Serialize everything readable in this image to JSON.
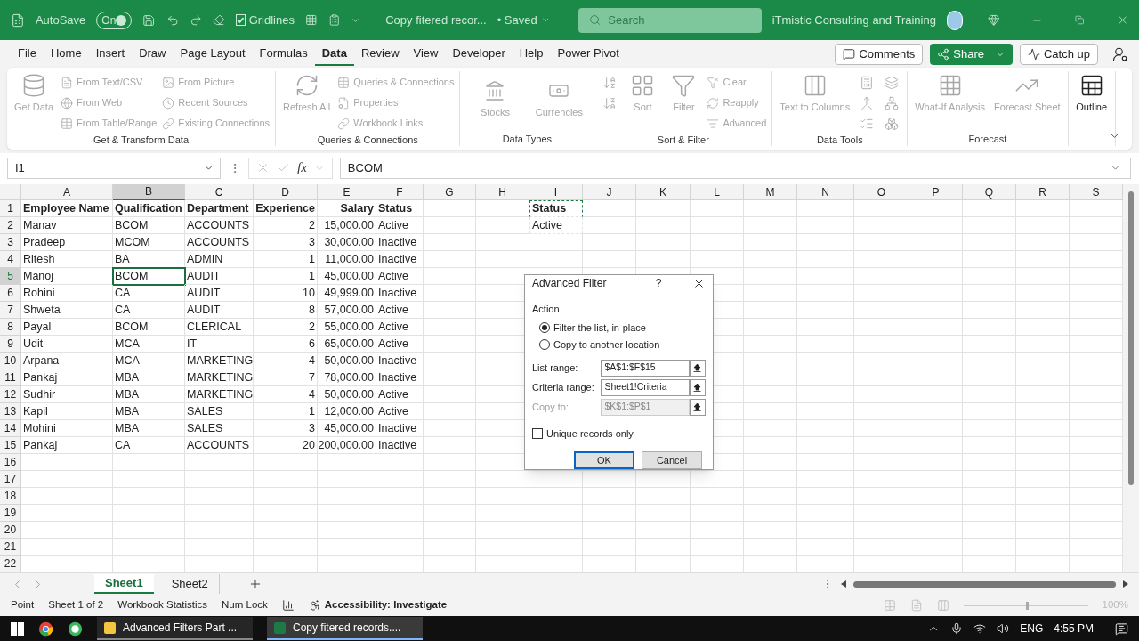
{
  "title_bar": {
    "autosave_label": "AutoSave",
    "autosave": {
      "label": "On",
      "on": true
    },
    "gridlines": {
      "label": "Gridlines",
      "checked": true
    },
    "document_title": "Copy fitered recor...",
    "save_status": "• Saved",
    "search": {
      "placeholder": "Search"
    },
    "account": "iTmistic Consulting and Training"
  },
  "menu_tabs": [
    {
      "label": "File",
      "selected": false
    },
    {
      "label": "Home",
      "selected": false
    },
    {
      "label": "Insert",
      "selected": false
    },
    {
      "label": "Draw",
      "selected": false
    },
    {
      "label": "Page Layout",
      "selected": false
    },
    {
      "label": "Formulas",
      "selected": false
    },
    {
      "label": "Data",
      "selected": true
    },
    {
      "label": "Review",
      "selected": false
    },
    {
      "label": "View",
      "selected": false
    },
    {
      "label": "Developer",
      "selected": false
    },
    {
      "label": "Help",
      "selected": false
    },
    {
      "label": "Power Pivot",
      "selected": false
    }
  ],
  "top_buttons": [
    {
      "label": "Comments",
      "kind": "outline"
    },
    {
      "label": "Share",
      "kind": "primary"
    },
    {
      "label": "Catch up",
      "kind": "outline"
    }
  ],
  "ribbon": [
    {
      "name": "Get & Transform Data",
      "items": [
        {
          "kind": "large",
          "label": "Get Data",
          "disabled": true
        },
        {
          "kind": "small",
          "label": "From Text/CSV",
          "disabled": true
        },
        {
          "kind": "small",
          "label": "From Web",
          "disabled": true
        },
        {
          "kind": "small",
          "label": "From Table/Range",
          "disabled": true
        },
        {
          "kind": "small",
          "label": "From Picture",
          "disabled": true
        },
        {
          "kind": "small",
          "label": "Recent Sources",
          "disabled": true
        },
        {
          "kind": "small",
          "label": "Existing Connections",
          "disabled": true
        }
      ]
    },
    {
      "name": "Queries & Connections",
      "items": [
        {
          "kind": "large",
          "label": "Refresh All",
          "disabled": true
        },
        {
          "kind": "small",
          "label": "Queries & Connections",
          "disabled": true
        },
        {
          "kind": "small",
          "label": "Properties",
          "disabled": true
        },
        {
          "kind": "small",
          "label": "Workbook Links",
          "disabled": true
        }
      ]
    },
    {
      "name": "Data Types",
      "items": [
        {
          "kind": "tile",
          "label": "Stocks",
          "disabled": true
        },
        {
          "kind": "tile",
          "label": "Currencies",
          "disabled": true
        }
      ]
    },
    {
      "name": "Sort & Filter",
      "items": [
        {
          "kind": "icon",
          "disabled": true
        },
        {
          "kind": "icon",
          "disabled": true
        },
        {
          "kind": "large",
          "label": "Sort",
          "disabled": true
        },
        {
          "kind": "large",
          "label": "Filter",
          "disabled": true
        },
        {
          "kind": "small",
          "label": "Clear",
          "disabled": true
        },
        {
          "kind": "small",
          "label": "Reapply",
          "disabled": true
        },
        {
          "kind": "small",
          "label": "Advanced",
          "disabled": true
        }
      ]
    },
    {
      "name": "Data Tools",
      "items": [
        {
          "kind": "large",
          "label": "Text to Columns",
          "disabled": true
        },
        {
          "kind": "icon",
          "disabled": true
        },
        {
          "kind": "icon",
          "disabled": true
        },
        {
          "kind": "icon",
          "disabled": true
        },
        {
          "kind": "icon",
          "disabled": true
        },
        {
          "kind": "icon",
          "disabled": true
        },
        {
          "kind": "icon",
          "disabled": true
        }
      ]
    },
    {
      "name": "Forecast",
      "items": [
        {
          "kind": "large",
          "label": "What-If Analysis",
          "disabled": true
        },
        {
          "kind": "large",
          "label": "Forecast Sheet",
          "disabled": true
        }
      ]
    },
    {
      "items": [
        {
          "kind": "large",
          "label": "Outline",
          "disabled": false
        }
      ]
    }
  ],
  "formula_bar": {
    "name_box": "I1",
    "fx": "fx",
    "value": "BCOM"
  },
  "columns": [
    {
      "label": "A",
      "selected": false,
      "numeric": false
    },
    {
      "label": "B",
      "selected": true,
      "numeric": false
    },
    {
      "label": "C",
      "selected": false,
      "numeric": false
    },
    {
      "label": "D",
      "selected": false,
      "numeric": true
    },
    {
      "label": "E",
      "selected": false,
      "numeric": true
    },
    {
      "label": "F",
      "selected": false,
      "numeric": false
    },
    {
      "label": "G",
      "selected": false
    },
    {
      "label": "H",
      "selected": false
    },
    {
      "label": "I",
      "selected": false
    },
    {
      "label": "J",
      "selected": false
    },
    {
      "label": "K",
      "selected": false
    },
    {
      "label": "L",
      "selected": false
    },
    {
      "label": "M",
      "selected": false
    },
    {
      "label": "N",
      "selected": false
    },
    {
      "label": "O",
      "selected": false
    },
    {
      "label": "P",
      "selected": false
    },
    {
      "label": "Q",
      "selected": false
    },
    {
      "label": "R",
      "selected": false
    },
    {
      "label": "S",
      "selected": false
    }
  ],
  "criteria": {
    "header": "Status",
    "value": "Active"
  },
  "rows": [
    {
      "number": "1",
      "kind": "header",
      "selected": false,
      "cells": [
        "Employee Name",
        "Qualification",
        "Department",
        "Experience",
        "Salary",
        "Status"
      ]
    },
    {
      "number": "2",
      "kind": "data",
      "selected": false,
      "cells": [
        "Manav",
        "BCOM",
        "ACCOUNTS",
        "2",
        "15,000.00",
        "Active"
      ]
    },
    {
      "number": "3",
      "kind": "data",
      "selected": false,
      "cells": [
        "Pradeep",
        "MCOM",
        "ACCOUNTS",
        "3",
        "30,000.00",
        "Inactive"
      ]
    },
    {
      "number": "4",
      "kind": "data",
      "selected": false,
      "cells": [
        "Ritesh",
        "BA",
        "ADMIN",
        "1",
        "11,000.00",
        "Inactive"
      ]
    },
    {
      "number": "5",
      "kind": "data",
      "selected": true,
      "cells": [
        "Manoj",
        "BCOM",
        "AUDIT",
        "1",
        "45,000.00",
        "Active"
      ]
    },
    {
      "number": "6",
      "kind": "data",
      "selected": false,
      "cells": [
        "Rohini",
        "CA",
        "AUDIT",
        "10",
        "49,999.00",
        "Inactive"
      ]
    },
    {
      "number": "7",
      "kind": "data",
      "selected": false,
      "cells": [
        "Shweta",
        "CA",
        "AUDIT",
        "8",
        "57,000.00",
        "Active"
      ]
    },
    {
      "number": "8",
      "kind": "data",
      "selected": false,
      "cells": [
        "Payal",
        "BCOM",
        "CLERICAL",
        "2",
        "55,000.00",
        "Active"
      ]
    },
    {
      "number": "9",
      "kind": "data",
      "selected": false,
      "cells": [
        "Udit",
        "MCA",
        "IT",
        "6",
        "65,000.00",
        "Active"
      ]
    },
    {
      "number": "10",
      "kind": "data",
      "selected": false,
      "cells": [
        "Arpana",
        "MCA",
        "MARKETING",
        "4",
        "50,000.00",
        "Inactive"
      ]
    },
    {
      "number": "11",
      "kind": "data",
      "selected": false,
      "cells": [
        "Pankaj",
        "MBA",
        "MARKETING",
        "7",
        "78,000.00",
        "Inactive"
      ]
    },
    {
      "number": "12",
      "kind": "data",
      "selected": false,
      "cells": [
        "Sudhir",
        "MBA",
        "MARKETING",
        "4",
        "50,000.00",
        "Active"
      ]
    },
    {
      "number": "13",
      "kind": "data",
      "selected": false,
      "cells": [
        "Kapil",
        "MBA",
        "SALES",
        "1",
        "12,000.00",
        "Active"
      ]
    },
    {
      "number": "14",
      "kind": "data",
      "selected": false,
      "cells": [
        "Mohini",
        "MBA",
        "SALES",
        "3",
        "45,000.00",
        "Inactive"
      ]
    },
    {
      "number": "15",
      "kind": "data",
      "selected": false,
      "cells": [
        "Pankaj",
        "CA",
        "ACCOUNTS",
        "20",
        "200,000.00",
        "Inactive"
      ]
    },
    {
      "number": "16",
      "kind": "data",
      "selected": false
    },
    {
      "number": "17",
      "kind": "data",
      "selected": false
    },
    {
      "number": "18",
      "kind": "data",
      "selected": false
    },
    {
      "number": "19",
      "kind": "data",
      "selected": false
    },
    {
      "number": "20",
      "kind": "data",
      "selected": false
    },
    {
      "number": "21",
      "kind": "data",
      "selected": false
    },
    {
      "number": "22",
      "kind": "data",
      "selected": false
    }
  ],
  "dialog": {
    "title": "Advanced Filter",
    "help": "?",
    "section": "Action",
    "options": [
      {
        "label": "Filter the list, in-place",
        "selected": true
      },
      {
        "label": "Copy to another location",
        "selected": false
      }
    ],
    "fields": [
      {
        "label": "List range:",
        "value": "$A$1:$F$15",
        "disabled": false
      },
      {
        "label": "Criteria range:",
        "value": "Sheet1!Criteria",
        "disabled": false
      },
      {
        "label": "Copy to:",
        "value": "$K$1:$P$1",
        "disabled": true
      }
    ],
    "unique": {
      "label": "Unique records only",
      "checked": false
    },
    "buttons": [
      {
        "label": "OK",
        "kind": "default"
      },
      {
        "label": "Cancel",
        "kind": "normal"
      }
    ]
  },
  "sheet_tabs": [
    {
      "label": "Sheet1",
      "selected": true
    },
    {
      "label": "Sheet2",
      "selected": false
    }
  ],
  "status_bar": {
    "items": [
      "Point",
      "Sheet 1 of 2",
      "Workbook Statistics",
      "Num Lock"
    ],
    "accessibility": "Accessibility: Investigate",
    "zoom": {
      "level": 0.5,
      "reading": "100%"
    }
  },
  "taskbar": {
    "apps": [
      {
        "label": "Advanced Filters Part ...",
        "kind": "folder",
        "selected": false
      },
      {
        "label": "Copy fitered records....",
        "kind": "excel",
        "selected": true
      }
    ],
    "language": "ENG",
    "time": "4:55 PM"
  }
}
